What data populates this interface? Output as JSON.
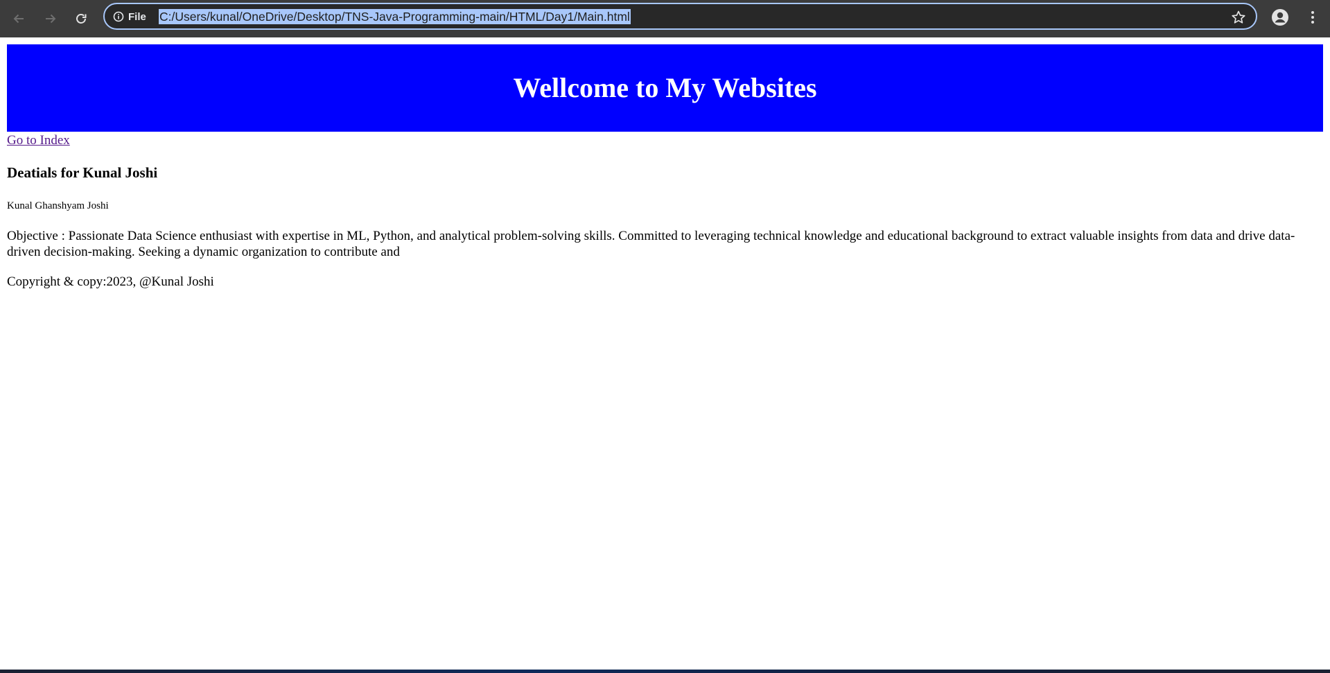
{
  "browser": {
    "site_info_label": "File",
    "url": "C:/Users/kunal/OneDrive/Desktop/TNS-Java-Programming-main/HTML/Day1/Main.html",
    "icons": {
      "back": "arrow-left-icon",
      "forward": "arrow-right-icon",
      "reload": "reload-icon",
      "site_info": "info-icon",
      "bookmark": "star-icon",
      "profile": "profile-icon",
      "menu": "kebab-menu-icon"
    },
    "accent_color": "#a8c7fa"
  },
  "page": {
    "header": {
      "title": "Wellcome to My Websites",
      "background_color": "#0000ff"
    },
    "index_link": "Go to Index",
    "details_heading": "Deatials for Kunal Joshi",
    "full_name": "Kunal Ghanshyam Joshi",
    "objective": "Objective : Passionate Data Science enthusiast with expertise in ML, Python, and analytical problem-solving skills. Committed to leveraging technical knowledge and educational background to extract valuable insights from data and drive data-driven decision-making. Seeking a dynamic organization to contribute and",
    "copyright": "Copyright & copy:2023, @Kunal Joshi"
  }
}
